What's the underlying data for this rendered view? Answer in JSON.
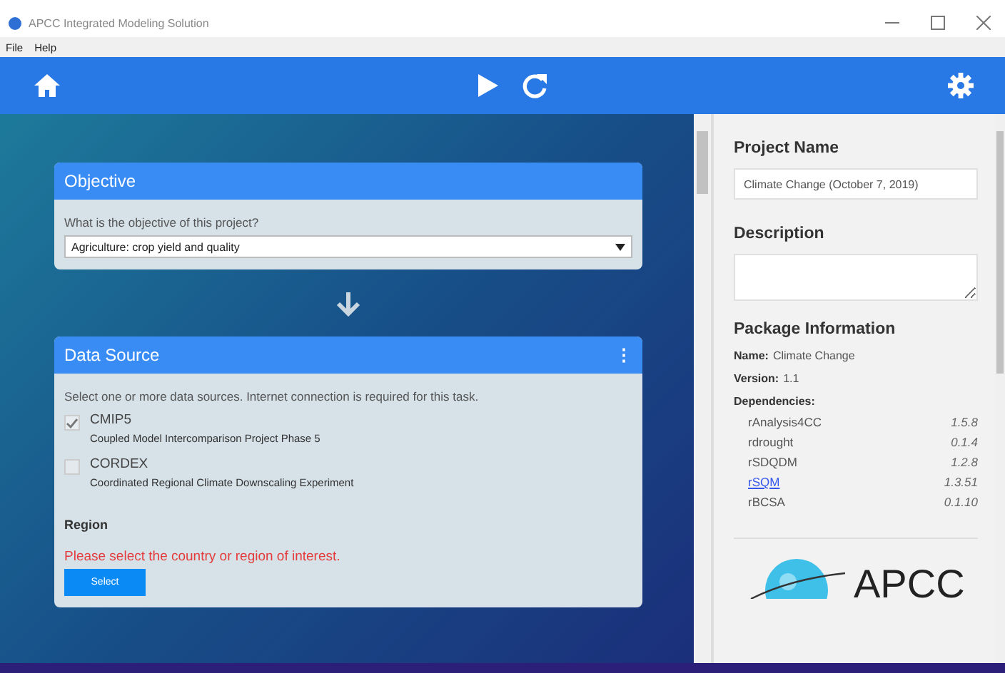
{
  "window": {
    "title": "APCC Integrated Modeling Solution"
  },
  "menu": [
    "File",
    "Help"
  ],
  "objective": {
    "title": "Objective",
    "question": "What is the objective of this project?",
    "value": "Agriculture: crop yield and quality"
  },
  "data_source": {
    "title": "Data Source",
    "menu_glyph": "⋮",
    "instruction": "Select one or more data sources. Internet connection is required for this task.",
    "sources": [
      {
        "name": "CMIP5",
        "description": "Coupled Model Intercomparison Project Phase 5",
        "checked": true
      },
      {
        "name": "CORDEX",
        "description": "Coordinated Regional Climate Downscaling Experiment",
        "checked": false
      }
    ],
    "region_label": "Region",
    "region_warning": "Please select the country or region of interest.",
    "select_button": "Select"
  },
  "side": {
    "project_name_label": "Project Name",
    "project_name": "Climate Change (October 7, 2019)",
    "description_label": "Description",
    "package_label": "Package Information",
    "name_key": "Name:",
    "name_value": "Climate Change",
    "version_key": "Version:",
    "version_value": "1.1",
    "dependencies_label": "Dependencies:",
    "dependencies": [
      {
        "name": "rAnalysis4CC",
        "version": "1.5.8",
        "kind": "text"
      },
      {
        "name": "rdrought",
        "version": "0.1.4",
        "kind": "text"
      },
      {
        "name": "rSDQDM",
        "version": "1.2.8",
        "kind": "text"
      },
      {
        "name": "rSQM",
        "version": "1.3.51",
        "kind": "link"
      },
      {
        "name": "rBCSA",
        "version": "0.1.10",
        "kind": "text"
      }
    ],
    "logo_text": "APCC"
  }
}
